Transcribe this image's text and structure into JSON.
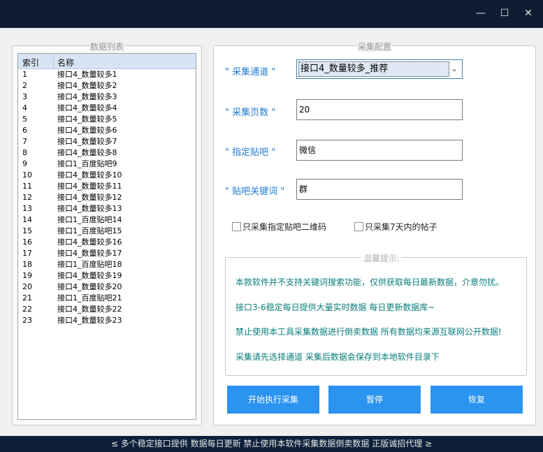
{
  "window": {
    "title": "",
    "min_icon": "—",
    "max_icon": "☐",
    "close_icon": "✕"
  },
  "left_panel": {
    "title": "数据列表",
    "columns": [
      "索引",
      "名称"
    ],
    "rows": [
      {
        "idx": "1",
        "name": "接口4_数量较多1"
      },
      {
        "idx": "2",
        "name": "接口4_数量较多2"
      },
      {
        "idx": "3",
        "name": "接口4_数量较多3"
      },
      {
        "idx": "4",
        "name": "接口4_数量较多4"
      },
      {
        "idx": "5",
        "name": "接口4_数量较多5"
      },
      {
        "idx": "6",
        "name": "接口4_数量较多6"
      },
      {
        "idx": "7",
        "name": "接口4_数量较多7"
      },
      {
        "idx": "8",
        "name": "接口4_数量较多8"
      },
      {
        "idx": "9",
        "name": "接口1_百度贴吧9"
      },
      {
        "idx": "10",
        "name": "接口4_数量较多10"
      },
      {
        "idx": "11",
        "name": "接口4_数量较多11"
      },
      {
        "idx": "12",
        "name": "接口4_数量较多12"
      },
      {
        "idx": "13",
        "name": "接口4_数量较多13"
      },
      {
        "idx": "14",
        "name": "接口1_百度贴吧14"
      },
      {
        "idx": "15",
        "name": "接口1_百度贴吧15"
      },
      {
        "idx": "16",
        "name": "接口4_数量较多16"
      },
      {
        "idx": "17",
        "name": "接口4_数量较多17"
      },
      {
        "idx": "18",
        "name": "接口1_百度贴吧18"
      },
      {
        "idx": "19",
        "name": "接口4_数量较多19"
      },
      {
        "idx": "20",
        "name": "接口4_数量较多20"
      },
      {
        "idx": "21",
        "name": "接口1_百度贴吧21"
      },
      {
        "idx": "22",
        "name": "接口4_数量较多22"
      },
      {
        "idx": "23",
        "name": "接口4_数量较多23"
      }
    ]
  },
  "config_panel": {
    "title": "采集配置",
    "channel_label": "\" 采集通道 \"",
    "channel_value": "接口4_数量较多_推荐",
    "pages_label": "\" 采集页数 \"",
    "pages_value": "20",
    "forum_label": "\" 指定贴吧 \"",
    "forum_value": "微信",
    "keyword_label": "\" 贴吧关键词 \"",
    "keyword_value": "群",
    "check_qr_label": "只采集指定贴吧二维码",
    "check_7days_label": "只采集7天内的帖子",
    "tips_title": "温馨提示:",
    "tips": [
      "本款软件并不支持关键词搜索功能，仅供获取每日最新数据，介意勿扰。",
      "接口3-6稳定每日提供大量实时数据 每日更新数据库~",
      "禁止使用本工具采集数据进行倒卖数据 所有数据均来源互联网公开数据!",
      "采集请先选择通道 采集后数据会保存到本地软件目录下"
    ],
    "buttons": {
      "start": "开始执行采集",
      "pause": "暂停",
      "resume": "恢复"
    }
  },
  "statusbar": {
    "text": "≤ 多个稳定接口提供 数据每日更新 禁止使用本软件采集数据倒卖数据 正版诚招代理 ≥"
  }
}
